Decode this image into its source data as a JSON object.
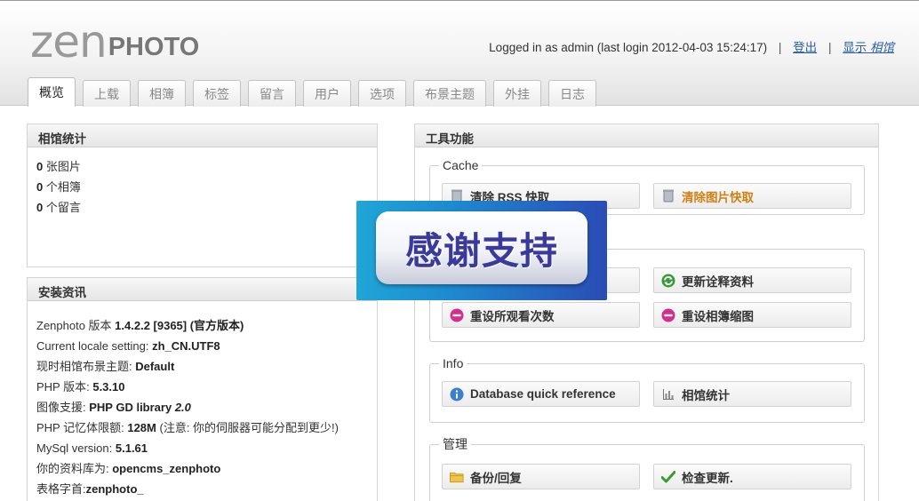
{
  "logo": {
    "zen": "zen",
    "photo": "PHOTO"
  },
  "login": {
    "text": "Logged in as admin (last login 2012-04-03 15:24:17)",
    "logout": "登出",
    "show_label": "显示",
    "show_target": "相馆"
  },
  "tabs": [
    {
      "label": "概览",
      "active": true
    },
    {
      "label": "上载"
    },
    {
      "label": "相簿"
    },
    {
      "label": "标签"
    },
    {
      "label": "留言"
    },
    {
      "label": "用户"
    },
    {
      "label": "选项"
    },
    {
      "label": "布景主题"
    },
    {
      "label": "外挂"
    },
    {
      "label": "日志"
    }
  ],
  "stats": {
    "title": "相馆统计",
    "images_count": "0",
    "images_label": "张图片",
    "albums_count": "0",
    "albums_label": "个相簿",
    "comments_count": "0",
    "comments_label": "个留言"
  },
  "install": {
    "title": "安装资讯",
    "rows": [
      {
        "label": "Zenphoto 版本 ",
        "value": "1.4.2.2 [9365] (官方版本)",
        "suffix": ""
      },
      {
        "label": "Current locale setting: ",
        "value": "zh_CN.UTF8",
        "suffix": ""
      },
      {
        "label": "现时相馆布景主题: ",
        "value": "Default",
        "suffix": ""
      },
      {
        "label": "PHP 版本: ",
        "value": "5.3.10",
        "suffix": ""
      },
      {
        "label": "图像支援: ",
        "value": "PHP GD library ",
        "value_italic": "2.0",
        "suffix": ""
      },
      {
        "label": "PHP 记忆体限额: ",
        "value": "128M",
        "suffix": " (注意: 你的伺服器可能分配到更少!)"
      },
      {
        "label": "MySql version: ",
        "value": "5.1.61",
        "suffix": ""
      },
      {
        "label": "你的资料库为: ",
        "value": "opencms_zenphoto",
        "suffix": ""
      },
      {
        "label": "表格字首:",
        "value": "zenphoto_",
        "suffix": ""
      }
    ]
  },
  "tools": {
    "title": "工具功能",
    "cache": {
      "legend": "Cache",
      "clear_rss": "清除 RSS 快取",
      "clear_image_cache": "清除图片快取"
    },
    "db": {
      "refresh_metadata": "更新诠释资料",
      "reset_hitcounters": "重设所观看次数",
      "reset_album_thumbs": "重设相簿缩图"
    },
    "info": {
      "legend": "Info",
      "db_reference": "Database quick reference",
      "gallery_stats": "相馆统计"
    },
    "admin": {
      "legend": "管理",
      "backup_restore": "备份/回复",
      "check_updates": "检查更新."
    }
  },
  "overlay": {
    "text": "感谢支持"
  },
  "colors": {
    "link": "#2a5fa8",
    "highlight": "#d07f12",
    "badge_blue": "#1e88cf",
    "badge_text": "#3b3a9c"
  }
}
